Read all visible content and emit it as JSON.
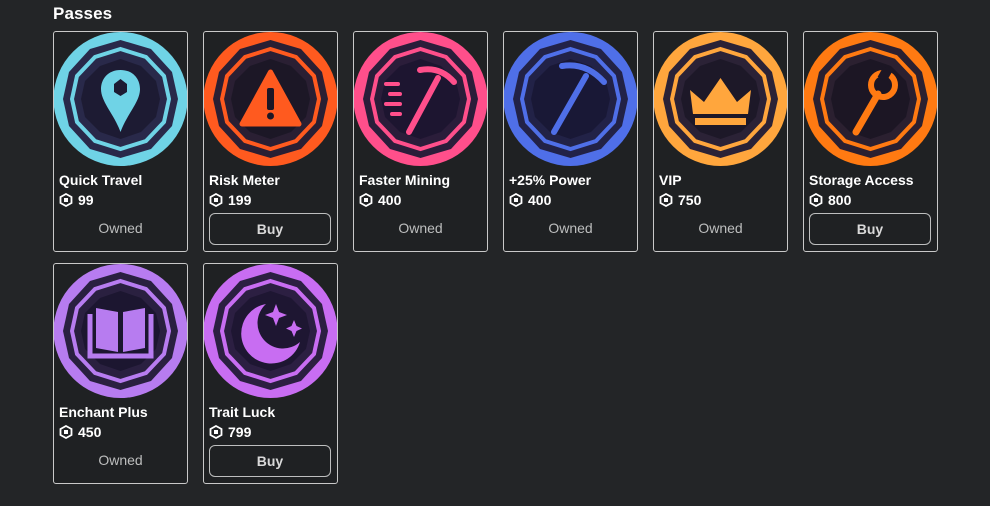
{
  "section": {
    "title": "Passes"
  },
  "passes": [
    {
      "name": "Quick Travel",
      "price": "99",
      "status": "Owned",
      "icon": "location-pin-icon",
      "color": "#6fd3e6"
    },
    {
      "name": "Risk Meter",
      "price": "199",
      "status": "Buy",
      "icon": "warning-icon",
      "color": "#ff5a1f"
    },
    {
      "name": "Faster Mining",
      "price": "400",
      "status": "Owned",
      "icon": "fast-pickaxe-icon",
      "color": "#ff4f8b"
    },
    {
      "name": "+25% Power",
      "price": "400",
      "status": "Owned",
      "icon": "pickaxe-icon",
      "color": "#4f6fe8"
    },
    {
      "name": "VIP",
      "price": "750",
      "status": "Owned",
      "icon": "crown-icon",
      "color": "#ffa63d"
    },
    {
      "name": "Storage Access",
      "price": "800",
      "status": "Buy",
      "icon": "wrench-icon",
      "color": "#ff7a12"
    },
    {
      "name": "Enchant Plus",
      "price": "450",
      "status": "Owned",
      "icon": "book-icon",
      "color": "#b77cf0"
    },
    {
      "name": "Trait Luck",
      "price": "799",
      "status": "Buy",
      "icon": "moon-stars-icon",
      "color": "#c86df2"
    }
  ],
  "currency_icon": "robux-icon"
}
